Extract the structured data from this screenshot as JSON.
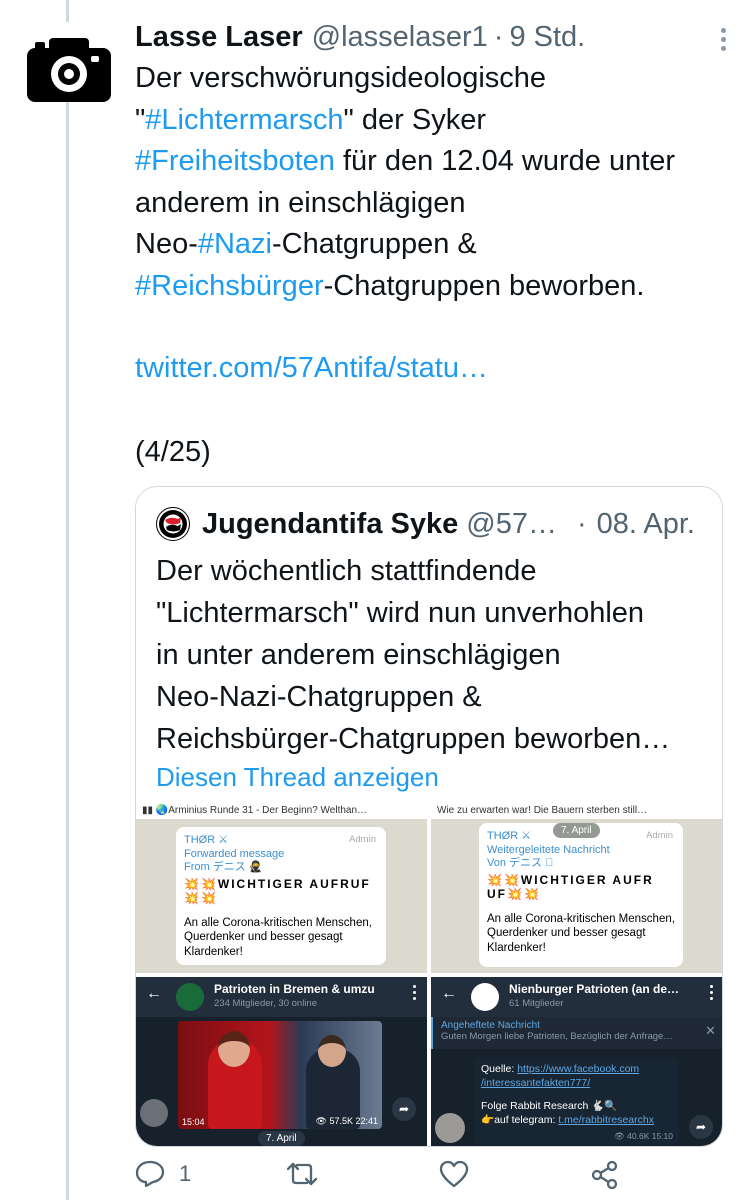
{
  "tweet": {
    "author_name": "Lasse Laser",
    "author_handle": "@lasselaser1",
    "separator": "·",
    "time": "9 Std.",
    "text_parts": [
      "Der verschwörungsideologische",
      "\"",
      "#Lichtermarsch",
      "\" der Syker",
      "#Freiheitsboten",
      " für den 12.04 wurde unter",
      "anderem in einschlägigen",
      "Neo-",
      "#Nazi",
      "-Chatgruppen &",
      "#Reichsbürger",
      "-Chatgruppen beworben."
    ],
    "link": "twitter.com/57Antifa/statu…",
    "counter": "(4/25)"
  },
  "quote": {
    "author_name": "Jugendantifa Syke",
    "author_handle": "@57…",
    "separator": "·",
    "time": "08. Apr.",
    "text_lines": [
      "Der wöchentlich stattfindende",
      "\"Lichtermarsch\" wird nun unverhohlen",
      "in unter anderem einschlägigen",
      "Neo-Nazi-Chatgruppen &",
      "Reichsbürger-Chatgruppen beworben…"
    ],
    "show_thread": "Diesen Thread anzeigen"
  },
  "media": {
    "top_left": {
      "strip": "Arminius Runde 31 - Der Beginn? Welthan…",
      "sender": "THØR ⚔",
      "admin": "Admin",
      "fwd_1": "Forwarded message",
      "fwd_2": "From デニス 🥷",
      "headline": "💥💥WICHTIGER AUFRUF💥💥",
      "body": "An alle Corona-kritischen Menschen, Querdenker und besser gesagt Klardenker!"
    },
    "top_right": {
      "strip": "Wie zu erwarten war!  Die Bauern sterben still…",
      "date": "7. April",
      "sender": "THØR ⚔",
      "admin": "Admin",
      "fwd_1": "Weitergeleitete Nachricht",
      "fwd_2": "Von デニス 🏻",
      "headline": "💥💥WICHTIGER AUFR UF💥💥",
      "body": "An alle Corona-kritischen Menschen, Querdenker und besser gesagt Klardenker!"
    },
    "bottom_left": {
      "title": "Patrioten in Bremen & umzu",
      "subtitle": "234 Mitglieder, 30 online",
      "views": "👁 57.5K  22:41",
      "time": "15:04",
      "date": "7. April"
    },
    "bottom_right": {
      "title": "Nienburger Patrioten (an de…",
      "subtitle": "61 Mitglieder",
      "pinned_title": "Angeheftete Nachricht",
      "pinned_text": "Guten Morgen liebe Patrioten,  Bezüglich der Anfrage…",
      "quelle_label": "Quelle: ",
      "quelle_link_1": "https://www.facebook.com",
      "quelle_link_2": "/interessantefakten777/",
      "folge": "Folge Rabbit Research 🐇🔍",
      "telegram_label": "👉auf telegram: ",
      "telegram_link": "t.me/rabbitresearchx",
      "views": "👁 40.6K  15:10"
    }
  },
  "actions": {
    "reply_count": "1"
  },
  "colors": {
    "link": "#1d9bf0",
    "secondary": "#536471",
    "border": "#cfd9de",
    "antifa_red": "#d6202b"
  }
}
